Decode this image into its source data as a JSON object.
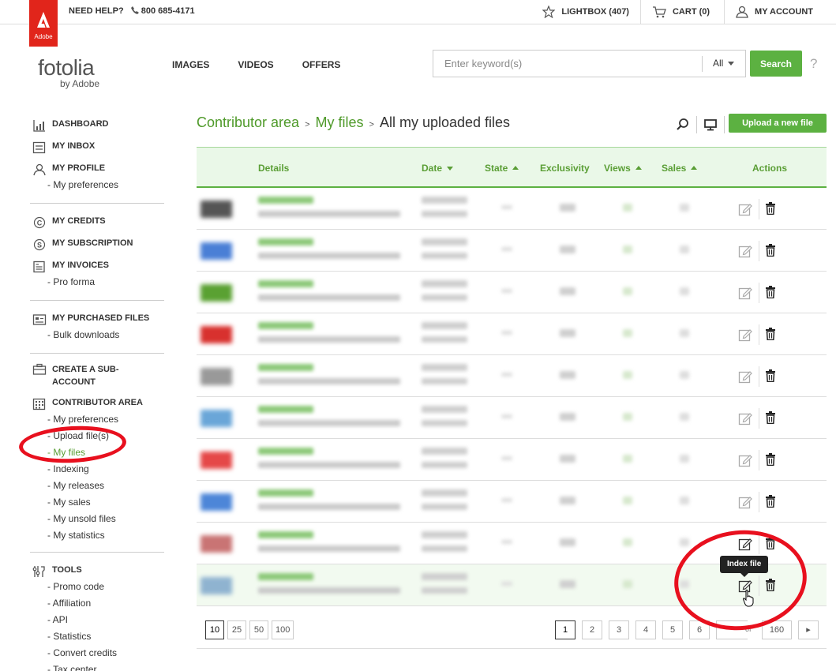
{
  "topbar": {
    "adobe_text": "Adobe",
    "help_label": "NEED HELP?",
    "phone": "800 685-4171",
    "lightbox": "LIGHTBOX (407)",
    "cart": "CART (0)",
    "account": "MY ACCOUNT"
  },
  "header": {
    "brand": "fotolia",
    "brand_sub": "by Adobe",
    "nav": [
      "IMAGES",
      "VIDEOS",
      "OFFERS"
    ],
    "search_placeholder": "Enter keyword(s)",
    "search_scope": "All",
    "search_button": "Search",
    "help_mark": "?"
  },
  "sidebar": {
    "dashboard": "DASHBOARD",
    "inbox": "MY INBOX",
    "profile": "MY PROFILE",
    "profile_prefs": "- My preferences",
    "credits": "MY CREDITS",
    "subscription": "MY SUBSCRIPTION",
    "invoices": "MY INVOICES",
    "pro_forma": "- Pro forma",
    "purchased": "MY PURCHASED FILES",
    "bulk": "- Bulk downloads",
    "sub_account_1": "CREATE A SUB-",
    "sub_account_2": "ACCOUNT",
    "contributor": "CONTRIBUTOR AREA",
    "c_prefs": "- My preferences",
    "c_upload": "- Upload file(s)",
    "c_myfiles": "- My files",
    "c_indexing": "- Indexing",
    "c_releases": "- My releases",
    "c_sales": "- My sales",
    "c_unsold": "- My unsold files",
    "c_stats": "- My statistics",
    "tools": "TOOLS",
    "t_promo": "- Promo code",
    "t_affil": "- Affiliation",
    "t_api": "- API",
    "t_stats": "- Statistics",
    "t_convert": "- Convert credits",
    "t_tax": "- Tax center"
  },
  "breadcrumb": {
    "c1": "Contributor area",
    "c2": "My files",
    "current": "All my uploaded files",
    "separator": ">"
  },
  "upload_button": "Upload a new file",
  "table": {
    "headers": {
      "details": "Details",
      "date": "Date",
      "state": "State",
      "exclusivity": "Exclusivity",
      "views": "Views",
      "sales": "Sales",
      "actions": "Actions"
    },
    "rows": [
      {
        "thumb_color": "#555555"
      },
      {
        "thumb_color": "#4a7fd6"
      },
      {
        "thumb_color": "#5aa132"
      },
      {
        "thumb_color": "#d8312e"
      },
      {
        "thumb_color": "#999999"
      },
      {
        "thumb_color": "#6aa6d8"
      },
      {
        "thumb_color": "#e54848"
      },
      {
        "thumb_color": "#4d86d8"
      },
      {
        "thumb_color": "#c97474"
      },
      {
        "thumb_color": "#8fb3d0"
      }
    ]
  },
  "tooltip": "Index file",
  "pagination": {
    "per_page": [
      "10",
      "25",
      "50",
      "100"
    ],
    "pages": [
      "1",
      "2",
      "3",
      "4",
      "5",
      "6"
    ],
    "of": "of",
    "last": "160",
    "next": "▸"
  },
  "colors": {
    "green": "#5cb141",
    "link_green": "#4f9a2a",
    "annotation_red": "#e8101e"
  }
}
